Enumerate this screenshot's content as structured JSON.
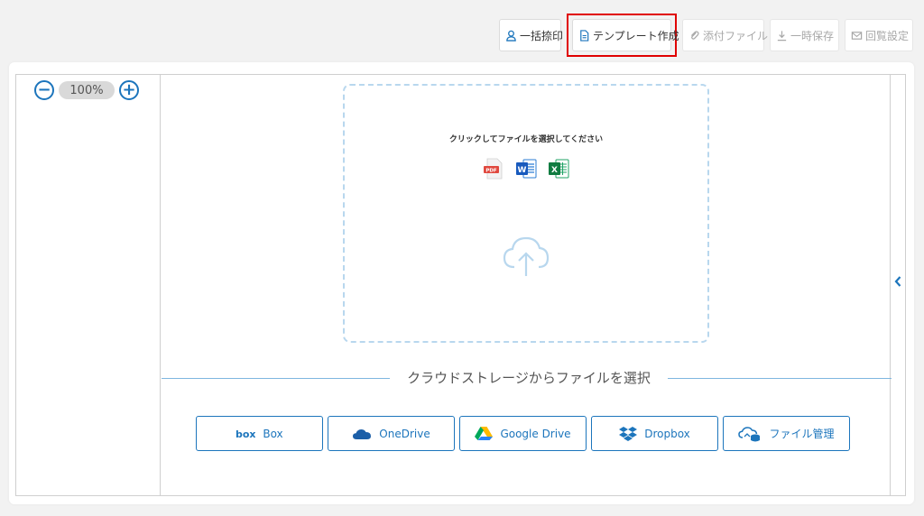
{
  "toolbar": {
    "bulk_stamp": "一括捺印",
    "create_template": "テンプレート作成",
    "attach_file": "添付ファイル",
    "temp_save": "一時保存",
    "circulation_settings": "回覧設定"
  },
  "viewer": {
    "zoom_level": "100%",
    "zoom_out": "−",
    "zoom_in": "+"
  },
  "dropzone": {
    "instruction": "クリックしてファイルを選択してください",
    "file_types": [
      "pdf-icon",
      "word-icon",
      "excel-icon"
    ],
    "upload_icon": "cloud-upload-icon"
  },
  "cloud": {
    "heading": "クラウドストレージからファイルを選択",
    "providers": [
      {
        "label": "Box",
        "icon": "box-logo-icon"
      },
      {
        "label": "OneDrive",
        "icon": "onedrive-icon"
      },
      {
        "label": "Google Drive",
        "icon": "google-drive-icon"
      },
      {
        "label": "Dropbox",
        "icon": "dropbox-icon"
      },
      {
        "label": "ファイル管理",
        "icon": "file-management-icon"
      }
    ]
  },
  "colors": {
    "accent": "#1c75bc",
    "highlight": "#e00000",
    "dashed_border": "#b8d7ee"
  }
}
